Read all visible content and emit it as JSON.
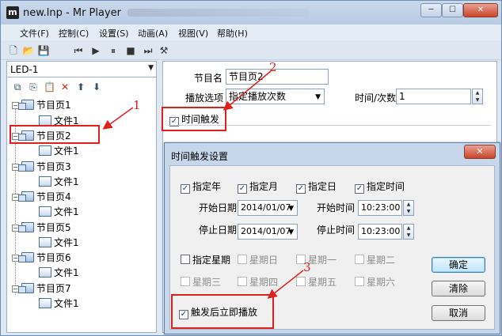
{
  "window": {
    "title": "new.lnp - Mr Player",
    "app_icon": "m",
    "min": "─",
    "max": "☐",
    "close": "✕"
  },
  "menu": [
    "文件(F)",
    "控制(C)",
    "设置(S)",
    "动画(A)",
    "视图(V)",
    "帮助(H)"
  ],
  "left": {
    "combo_value": "LED-1",
    "tree": [
      {
        "page": "节目页1",
        "file": "文件1"
      },
      {
        "page": "节目页2",
        "file": "文件1"
      },
      {
        "page": "节目页3",
        "file": "文件1"
      },
      {
        "page": "节目页4",
        "file": "文件1"
      },
      {
        "page": "节目页5",
        "file": "文件1"
      },
      {
        "page": "节目页6",
        "file": "文件1"
      },
      {
        "page": "节目页7",
        "file": "文件1"
      }
    ]
  },
  "right": {
    "name_label": "节目名",
    "name_value": "节目页2",
    "play_label": "播放选项",
    "play_value": "指定播放次数",
    "times_label": "时间/次数",
    "times_value": "1",
    "time_trigger_label": "时间触发",
    "time_trigger_checked": true
  },
  "dialog": {
    "title": "时间触发设置",
    "close": "✕",
    "chk_year": "指定年",
    "chk_month": "指定月",
    "chk_day": "指定日",
    "chk_time": "指定时间",
    "start_date_label": "开始日期",
    "start_date": "2014/01/07",
    "start_time_label": "开始时间",
    "start_time": "10:23:00",
    "stop_date_label": "停止日期",
    "stop_date": "2014/01/07",
    "stop_time_label": "停止时间",
    "stop_time": "10:23:00",
    "chk_weekday": "指定星期",
    "weekdays": [
      "星期日",
      "星期一",
      "星期二",
      "星期三",
      "星期四",
      "星期五",
      "星期六"
    ],
    "play_after_trigger": "触发后立即播放",
    "ok": "确定",
    "clear": "清除",
    "cancel": "取消"
  },
  "annotations": [
    "1",
    "2",
    "3"
  ],
  "colors": {
    "annotation": "#e0201a",
    "title_bar": "#c3d4ea"
  }
}
